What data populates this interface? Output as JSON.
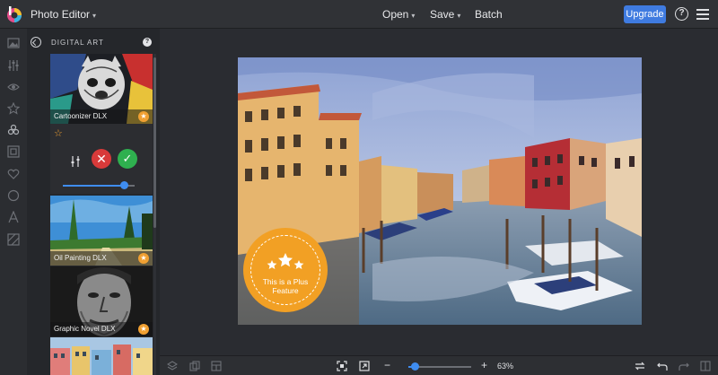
{
  "app": {
    "title": "Photo Editor"
  },
  "topbar": {
    "menus": [
      {
        "label": "Open"
      },
      {
        "label": "Save"
      },
      {
        "label": "Batch"
      }
    ],
    "upgrade_label": "Upgrade",
    "help_glyph": "?"
  },
  "rail": {
    "icons": [
      "image-icon",
      "adjust-sliders-icon",
      "eye-icon",
      "star-icon",
      "effects-icon",
      "frame-icon",
      "heart-icon",
      "shape-icon",
      "text-icon",
      "texture-icon"
    ]
  },
  "panel": {
    "title": "DIGITAL ART",
    "help_glyph": "?",
    "effects": [
      {
        "label": "Cartoonizer DLX",
        "premium": true
      },
      {
        "label": "Oil Painting DLX",
        "premium": true
      },
      {
        "label": "Graphic Novel DLX",
        "premium": true
      }
    ],
    "intensity": 0.85
  },
  "canvas": {
    "badge_text": [
      "This is a Plus",
      "Feature"
    ]
  },
  "bottombar": {
    "zoom_minus": "−",
    "zoom_plus": "+",
    "zoom_label": "63%",
    "zoom_fraction": 0.1
  },
  "colors": {
    "accent": "#3f7be0",
    "premium": "#f0a032",
    "cancel": "#d83a3a",
    "apply": "#2fb04f"
  }
}
